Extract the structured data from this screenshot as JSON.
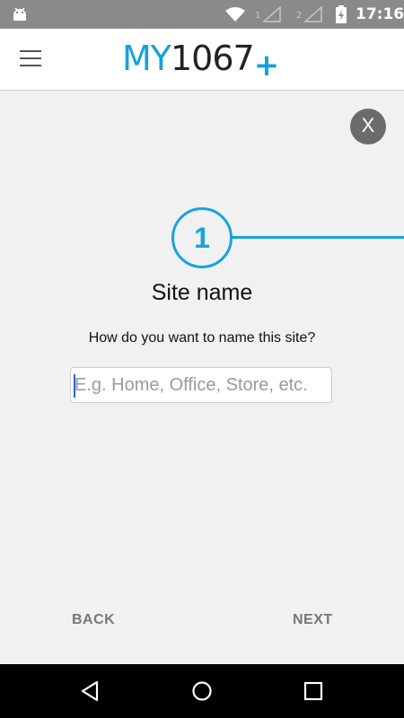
{
  "status_bar": {
    "time": "17:16",
    "sim1_label": "1",
    "sim2_label": "2",
    "icons": [
      "android-icon",
      "wifi-icon",
      "signal-icon",
      "signal-icon",
      "battery-icon"
    ]
  },
  "app_bar": {
    "logo": {
      "my": "MY",
      "number": "1067",
      "plus": "+"
    },
    "menu_icon": "hamburger-icon"
  },
  "close_button": {
    "label": "X"
  },
  "step": {
    "number": "1"
  },
  "form": {
    "title": "Site name",
    "question": "How do you want to name this site?",
    "input_value": "",
    "input_placeholder": "E.g. Home, Office, Store, etc."
  },
  "footer": {
    "back_label": "BACK",
    "next_label": "NEXT"
  },
  "nav_bar": {
    "icons": [
      "back-icon",
      "home-icon",
      "recents-icon"
    ]
  },
  "colors": {
    "accent": "#16a0db",
    "status_bar": "#8a8a8a",
    "close_button": "#6b6b6b"
  }
}
